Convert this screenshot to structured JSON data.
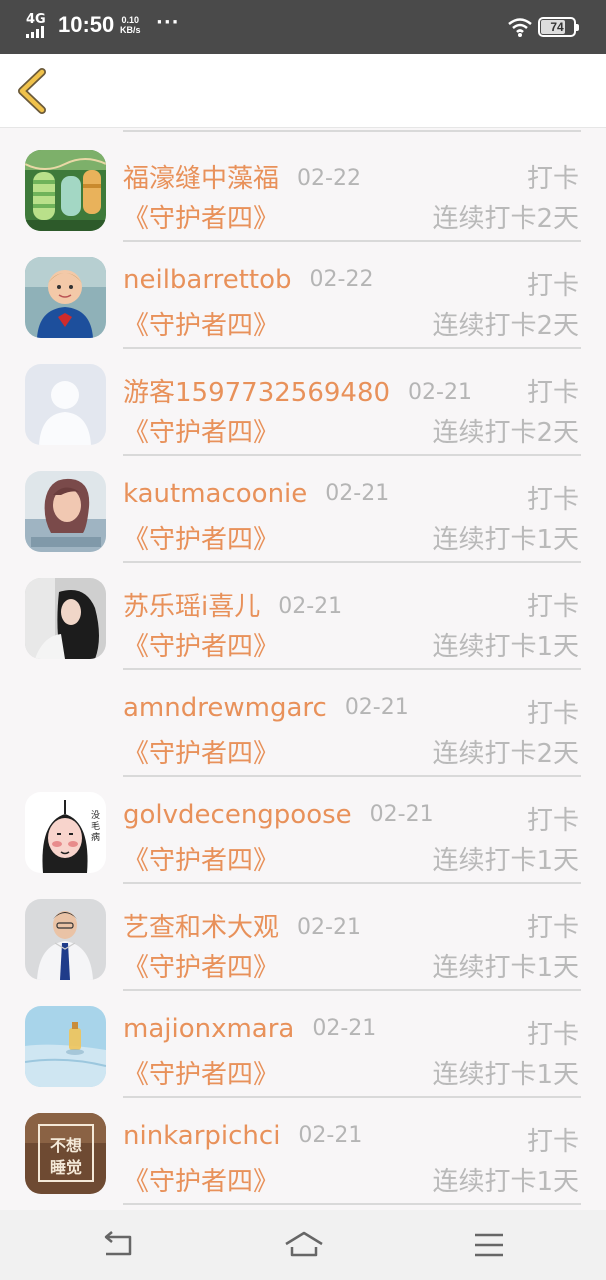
{
  "status_bar": {
    "network": "4G",
    "time": "10:50",
    "speed_value": "0.10",
    "speed_unit": "KB/s",
    "more": "···",
    "battery": "74",
    "battery_level": 0.74
  },
  "header": {
    "back_icon": "chevron-left-icon",
    "back_color": "#e6b33a"
  },
  "colors": {
    "accent": "#e8915a",
    "muted": "#b9b9b9",
    "divider": "#d9d9d9"
  },
  "checkins": [
    {
      "name": "福濠缝中藻福",
      "date": "02-22",
      "action": "打卡",
      "book": "《守护者四》",
      "streak": "连续打卡2天",
      "avatar": "paper-lanterns-photo"
    },
    {
      "name": "neilbarrettob",
      "date": "02-22",
      "action": "打卡",
      "book": "《守护者四》",
      "streak": "连续打卡2天",
      "avatar": "child-photo"
    },
    {
      "name": "游客1597732569480",
      "date": "02-21",
      "action": "打卡",
      "book": "《守护者四》",
      "streak": "连续打卡2天",
      "avatar": "default-user-silhouette"
    },
    {
      "name": "kautmacoonie",
      "date": "02-21",
      "action": "打卡",
      "book": "《守护者四》",
      "streak": "连续打卡1天",
      "avatar": "woman-portrait-photo"
    },
    {
      "name": "苏乐瑶i喜儿",
      "date": "02-21",
      "action": "打卡",
      "book": "《守护者四》",
      "streak": "连续打卡1天",
      "avatar": "girl-photo"
    },
    {
      "name": "amndrewmgarc",
      "date": "02-21",
      "action": "打卡",
      "book": "《守护者四》",
      "streak": "连续打卡2天",
      "avatar": "none"
    },
    {
      "name": "golvdecengpoose",
      "date": "02-21",
      "action": "打卡",
      "book": "《守护者四》",
      "streak": "连续打卡1天",
      "avatar": "cartoon-sketch"
    },
    {
      "name": "艺查和术大观",
      "date": "02-21",
      "action": "打卡",
      "book": "《守护者四》",
      "streak": "连续打卡1天",
      "avatar": "man-in-suit-photo"
    },
    {
      "name": "majionxmara",
      "date": "02-21",
      "action": "打卡",
      "book": "《守护者四》",
      "streak": "连续打卡1天",
      "avatar": "bottle-photo"
    },
    {
      "name": "ninkarpichci",
      "date": "02-21",
      "action": "打卡",
      "book": "《守护者四》",
      "streak": "连续打卡1天",
      "avatar": "calligraphy-image",
      "avatar_text_1": "不想",
      "avatar_text_2": "睡觉"
    }
  ],
  "nav_bar": {
    "back_icon": "back-arrow-icon",
    "home_icon": "home-icon",
    "menu_icon": "menu-icon"
  }
}
